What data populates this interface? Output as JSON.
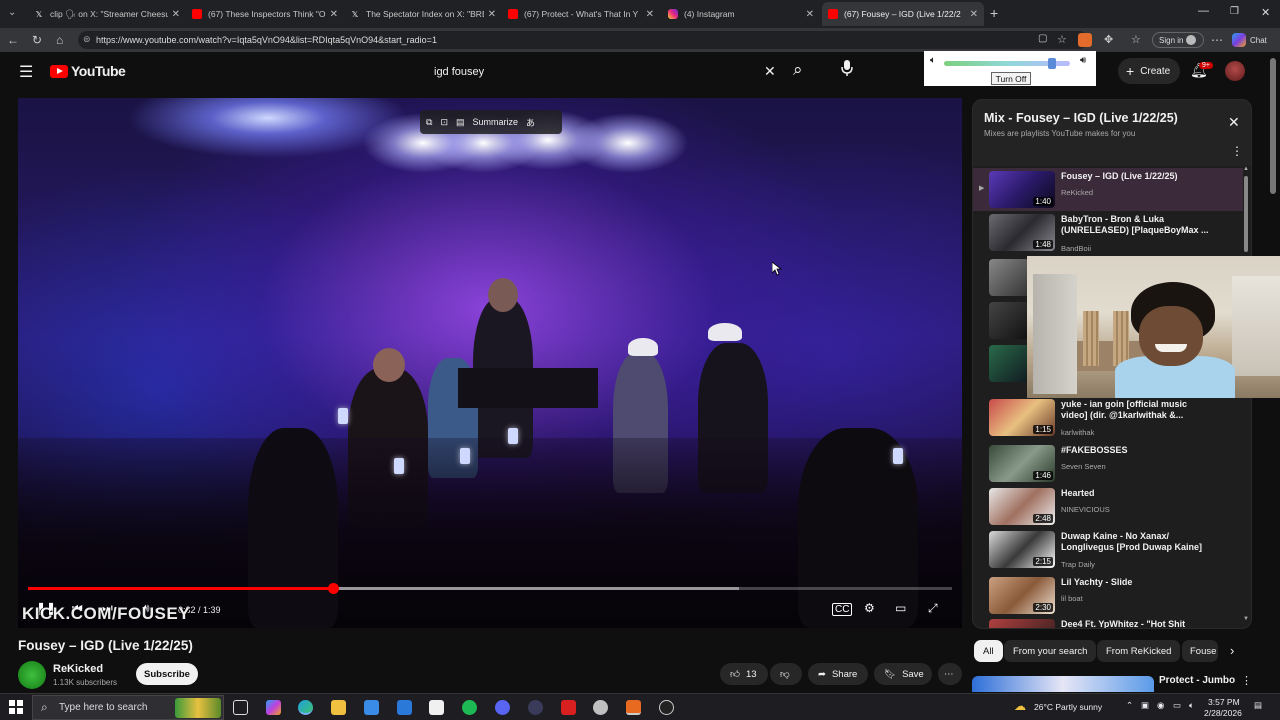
{
  "browser": {
    "tabs": [
      {
        "label": "clip 🗣 on X: \"Streamer Cheesur p",
        "icon": "x-icon",
        "active": false
      },
      {
        "label": "(67) These Inspectors Think \"Open",
        "icon": "youtube-icon",
        "active": false
      },
      {
        "label": "The Spectator Index on X: \"BREAK",
        "icon": "x-icon",
        "active": false
      },
      {
        "label": "(67) Protect - What's That In Y",
        "icon": "youtube-icon",
        "active": false
      },
      {
        "label": "(4) Instagram",
        "icon": "instagram-icon",
        "active": false
      },
      {
        "label": "(67) Fousey – IGD (Live 1/22/2",
        "icon": "youtube-icon",
        "active": true
      }
    ],
    "url": "https://www.youtube.com/watch?v=Iqta5qVnO94&list=RDIqta5qVnO94&start_radio=1",
    "sign_in": "Sign in",
    "chat": "Chat"
  },
  "header": {
    "logo": "YouTube",
    "search_value": "igd fousey",
    "create": "Create",
    "notif_badge": "9+"
  },
  "volume_popup": {
    "button": "Turn Off",
    "level": 0.86
  },
  "player": {
    "overlay_summarize": "Summarize",
    "watermark": "KICK.COM/FOUSEY",
    "time": "0:32 / 1:39",
    "progress": 0.33,
    "buffered": 0.77
  },
  "video": {
    "title": "Fousey – IGD (Live 1/22/25)",
    "channel": "ReKicked",
    "subscribers": "1.13K subscribers",
    "subscribe": "Subscribe",
    "likes": "13",
    "share": "Share",
    "save": "Save"
  },
  "mix": {
    "title": "Mix - Fousey – IGD (Live 1/22/25)",
    "subtitle": "Mixes are playlists YouTube makes for you",
    "items": [
      {
        "title": "Fousey – IGD (Live 1/22/25)",
        "channel": "ReKicked",
        "duration": "1:40",
        "current": true
      },
      {
        "title": "BabyTron - Bron & Luka (UNRELEASED) [PlaqueBoyMax ...",
        "channel": "BandBoii",
        "duration": "1:48",
        "current": false
      },
      {
        "title": "yuke - ian goin [official music video] (dir. @1karlwithak &...",
        "channel": "karlwithak",
        "duration": "1:15",
        "current": false
      },
      {
        "title": "#FAKEBOSSES",
        "channel": "Seven Seven",
        "duration": "1:46",
        "current": false
      },
      {
        "title": "Hearted",
        "channel": "NINEVICIOUS",
        "duration": "2:48",
        "current": false
      },
      {
        "title": "Duwap Kaine - No Xanax/ Longlivegus [Prod Duwap Kaine]",
        "channel": "Trap Daily",
        "duration": "2:15",
        "current": false
      },
      {
        "title": "Lil Yachty - Slide",
        "channel": "lil boat",
        "duration": "2:30",
        "current": false
      },
      {
        "title": "Dee4 Ft. YpWhitez - \"Hot Shit",
        "channel": "",
        "duration": "",
        "current": false
      }
    ]
  },
  "chips": [
    "All",
    "From your search",
    "From ReKicked",
    "Fouse"
  ],
  "recommendation": {
    "title": "Protect - Jumbo"
  },
  "taskbar": {
    "search_placeholder": "Type here to search",
    "weather": "26°C  Partly sunny",
    "time": "3:57 PM",
    "date": "2/28/2026"
  }
}
